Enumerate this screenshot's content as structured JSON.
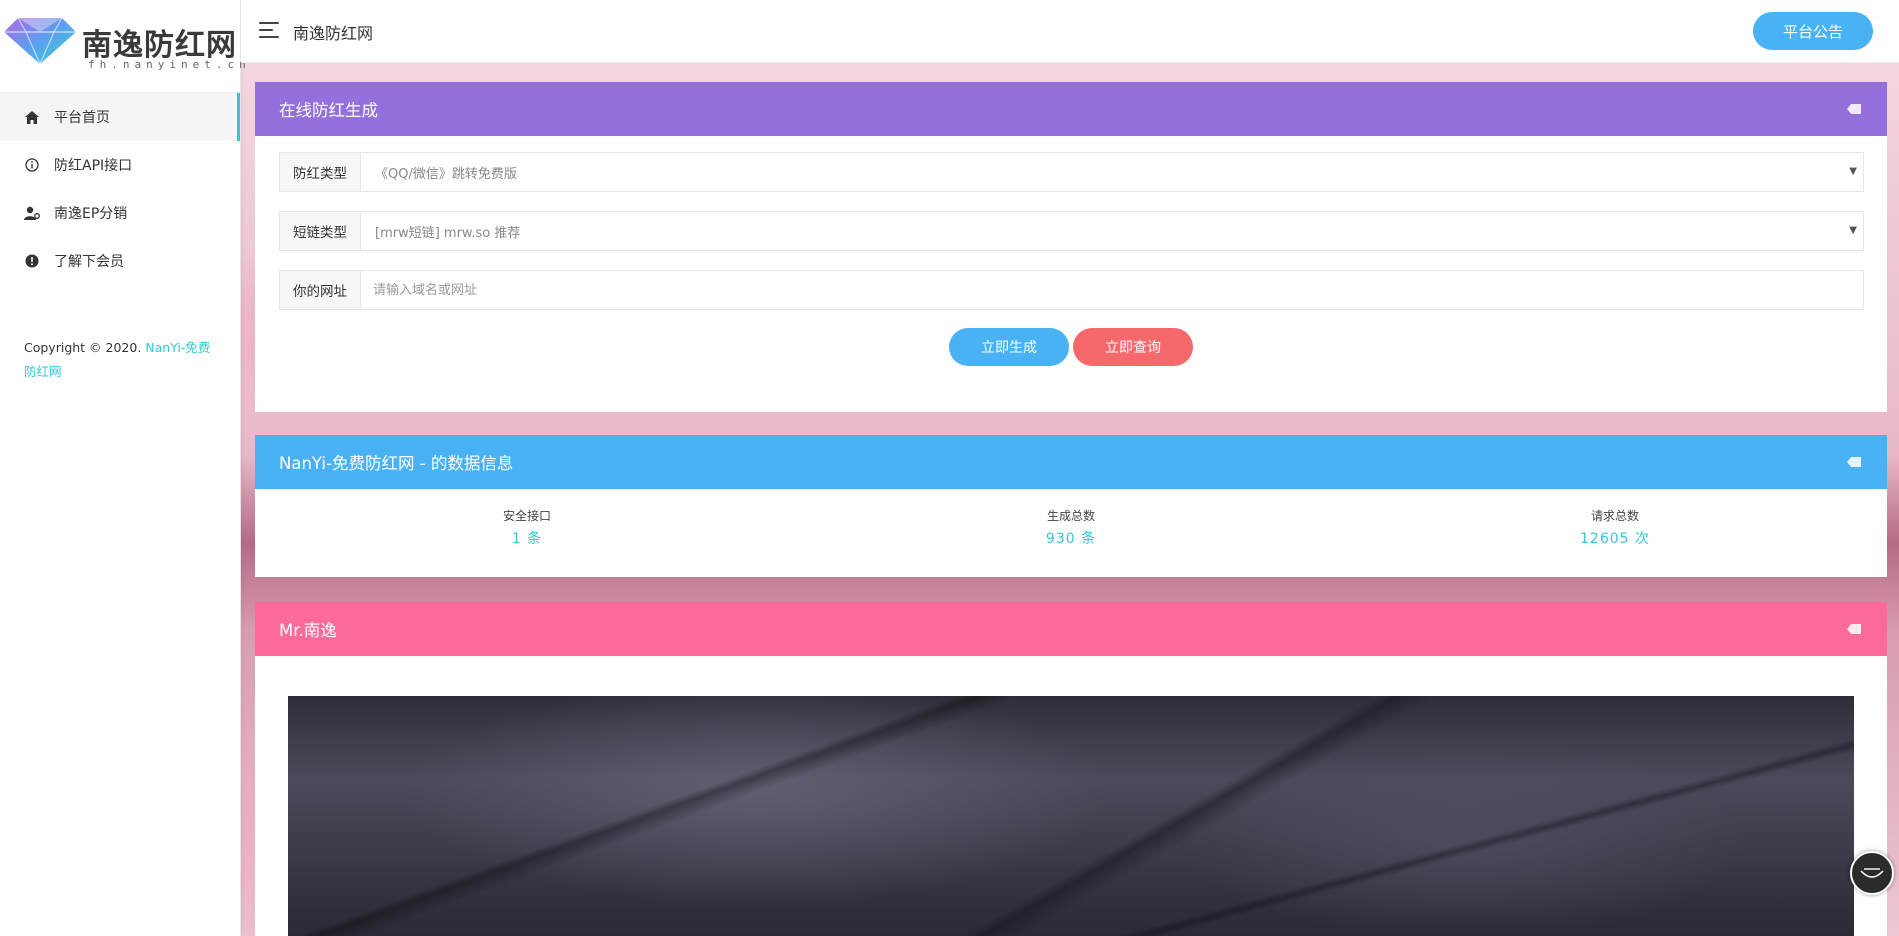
{
  "logo": {
    "brand": "南逸防红网",
    "sub": "fh.nanyinet.cn"
  },
  "sidebar": {
    "items": [
      {
        "label": "平台首页",
        "icon": "home-icon",
        "active": true
      },
      {
        "label": "防红API接口",
        "icon": "info-circle-icon"
      },
      {
        "label": "南逸EP分销",
        "icon": "user-gear-icon"
      },
      {
        "label": "了解下会员",
        "icon": "exclamation-circle-icon"
      }
    ],
    "copyright_prefix": "Copyright © 2020. ",
    "copyright_link": "NanYi-免费防红网"
  },
  "topbar": {
    "title": "南逸防红网",
    "notice_button": "平台公告"
  },
  "generator": {
    "title": "在线防红生成",
    "type_label": "防红类型",
    "type_value": "《QQ/微信》跳转免费版",
    "short_label": "短链类型",
    "short_value": "[mrw短链] mrw.so 推荐",
    "url_label": "你的网址",
    "url_placeholder": "请输入域名或网址",
    "generate_button": "立即生成",
    "query_button": "立即查询"
  },
  "stats": {
    "title": "NanYi-免费防红网 - 的数据信息",
    "items": [
      {
        "key": "安全接口",
        "value": "1 条"
      },
      {
        "key": "生成总数",
        "value": "930 条"
      },
      {
        "key": "请求总数",
        "value": "12605 次"
      }
    ]
  },
  "profile": {
    "title": "Mr.南逸"
  },
  "colors": {
    "accent": "#36c6d3",
    "purple": "#9370db",
    "blue": "#49b2f5",
    "pink": "#fb6a99",
    "red": "#f5696c"
  }
}
